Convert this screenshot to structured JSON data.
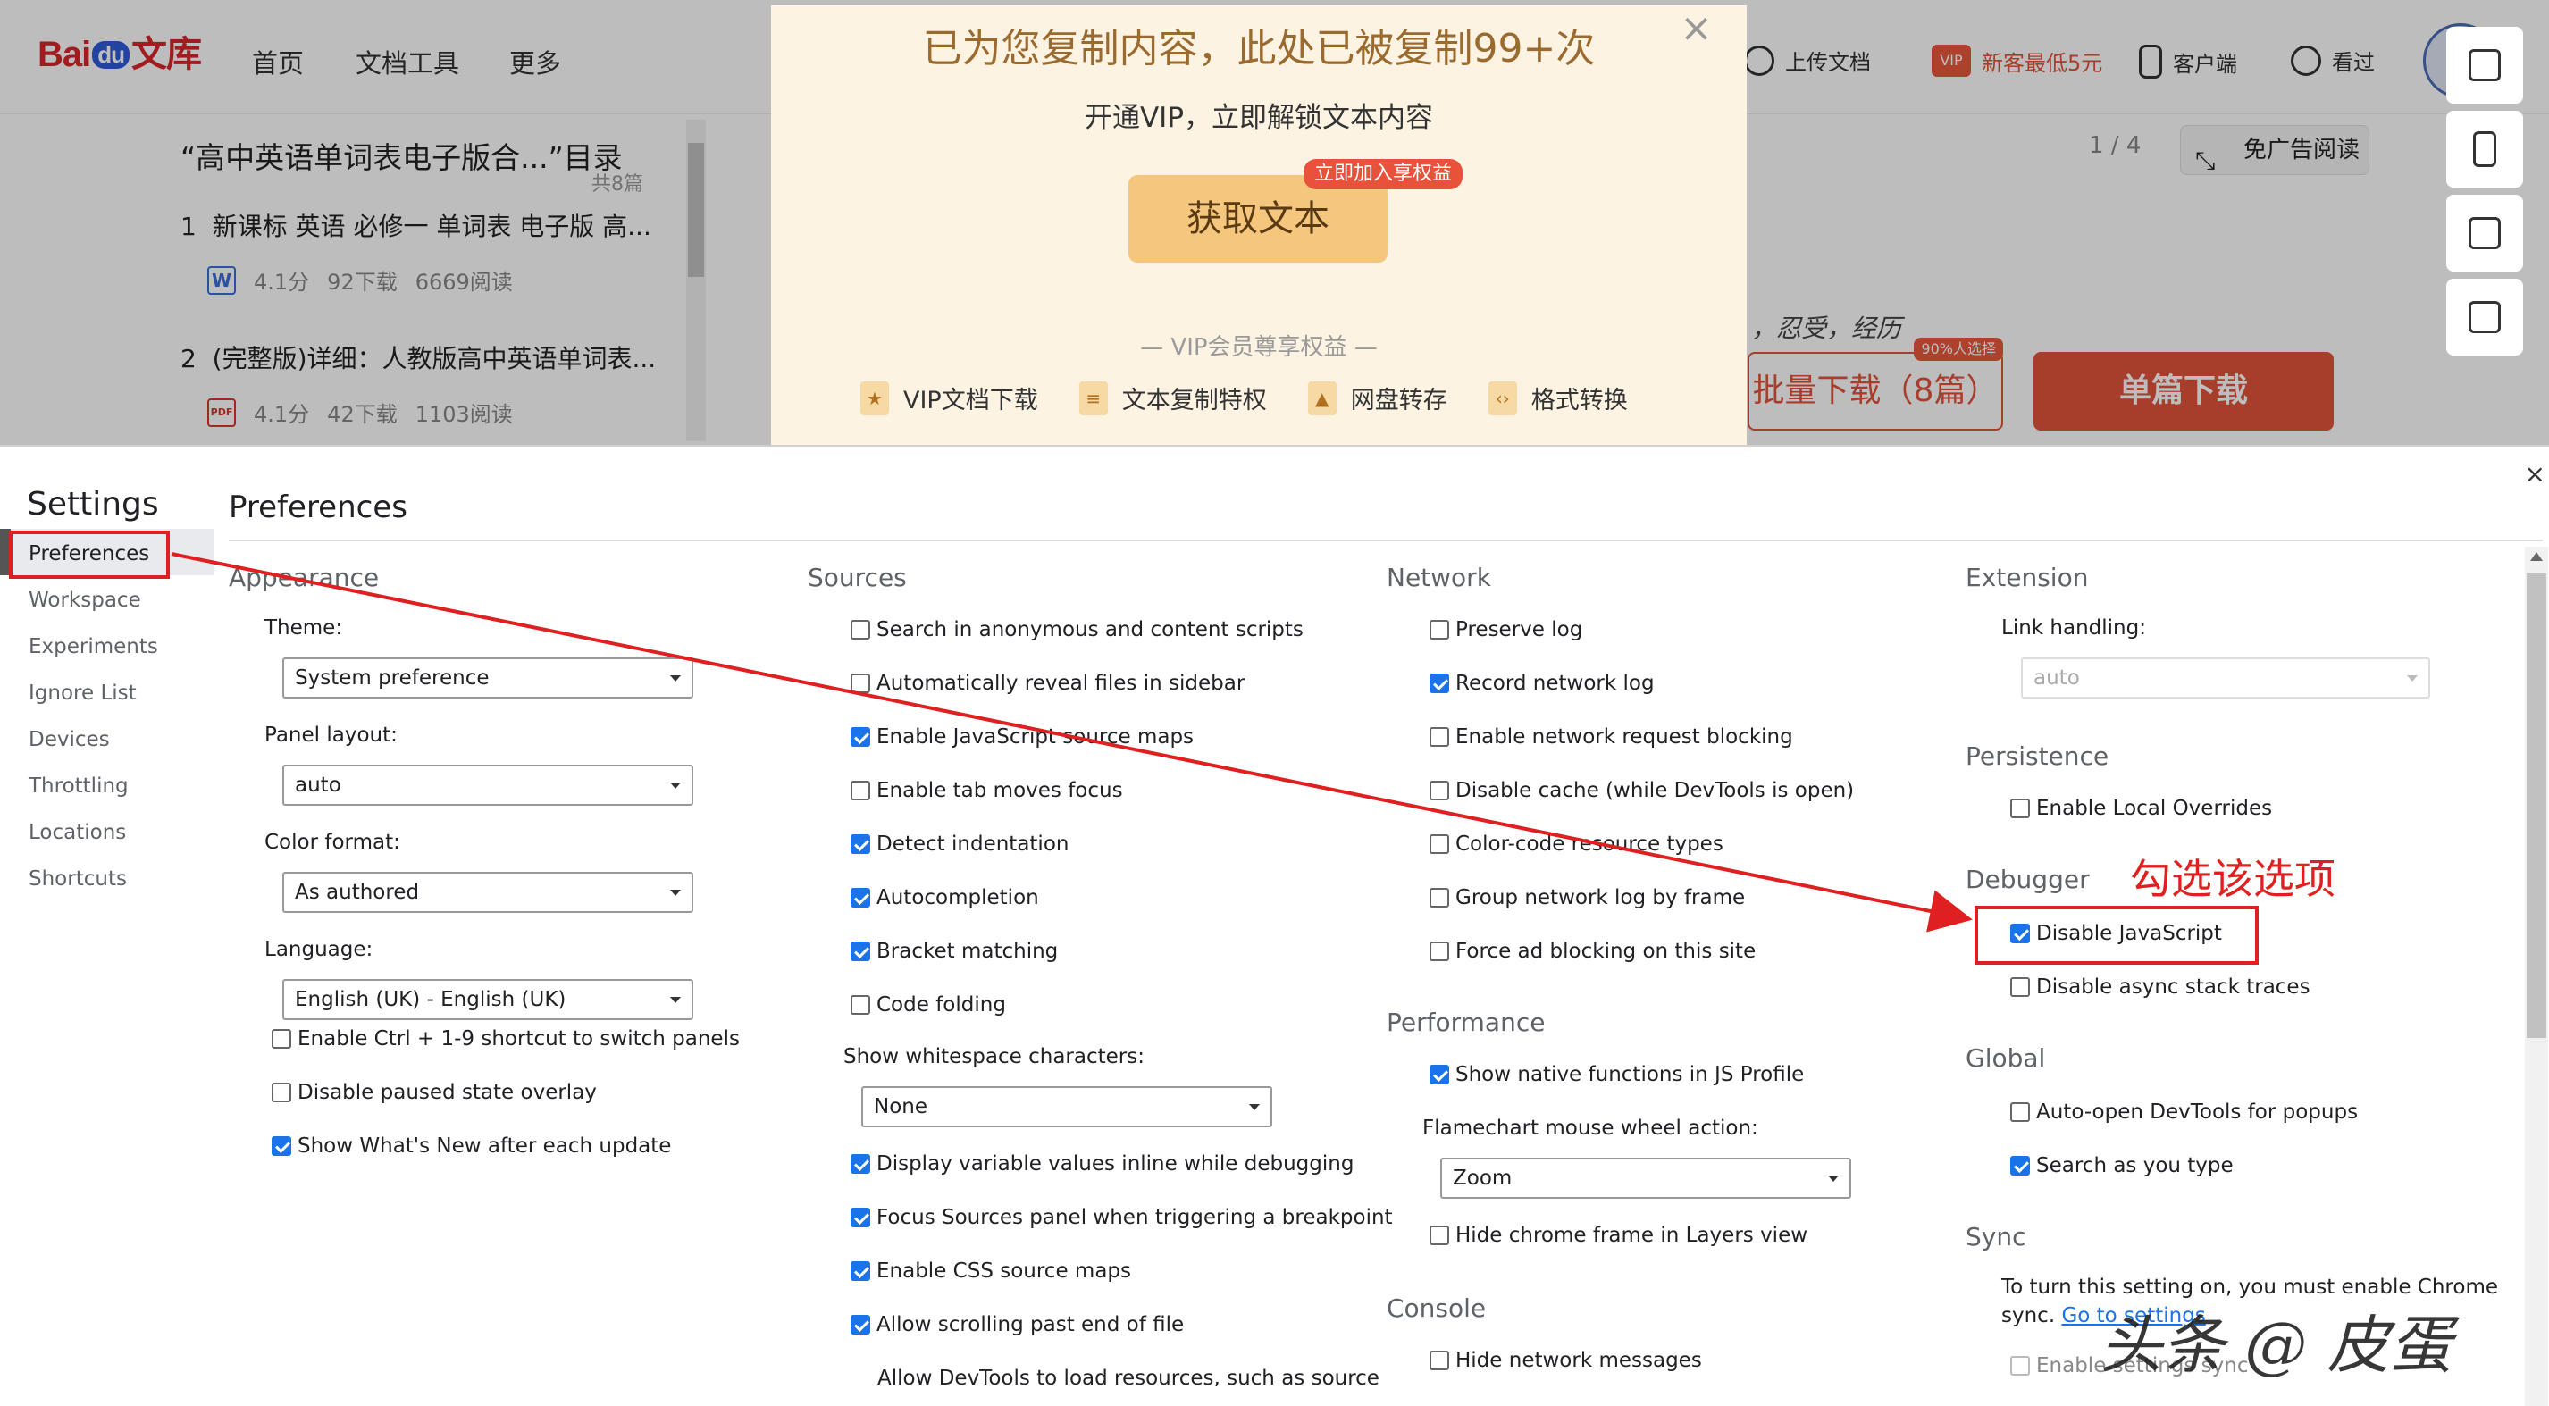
{
  "web": {
    "logo": {
      "left": "Bai",
      "du": "du",
      "right": "文库"
    },
    "nav_links": [
      "首页",
      "文档工具",
      "更多"
    ],
    "nav_right": {
      "upload": "上传文档",
      "vip_badge": "VIP",
      "promo": "新客最低5元",
      "client": "客户端",
      "history": "看过"
    },
    "toc": {
      "title": "“高中英语单词表电子版合...”目录",
      "count": "共8篇",
      "items": [
        {
          "index": "1",
          "title": "新课标 英语 必修一 单词表 电子版 高...",
          "type": "W",
          "score": "4.1分",
          "downloads": "92下载",
          "reads": "6669阅读"
        },
        {
          "index": "2",
          "title": "(完整版)详细：人教版高中英语单词表...",
          "type": "PDF",
          "score": "4.1分",
          "downloads": "42下载",
          "reads": "1103阅读"
        }
      ]
    },
    "page_indicator": "1 / 4",
    "no_ad": "免广告阅读",
    "doc_text": "，忍受，经历",
    "batch_download": "批量下载（8篇）",
    "batch_tag": "90%人选择",
    "single_download": "单篇下载"
  },
  "popup": {
    "title": "已为您复制内容，此处已被复制99+次",
    "subtitle": "开通VIP，立即解锁文本内容",
    "button": "获取文本",
    "badge": "立即加入享权益",
    "vip_title": "— VIP会员尊享权益 —",
    "features": [
      "VIP文档下载",
      "文本复制特权",
      "网盘转存",
      "格式转换"
    ],
    "close": "×"
  },
  "devtools": {
    "settings_title": "Settings",
    "close": "×",
    "nav": [
      "Preferences",
      "Workspace",
      "Experiments",
      "Ignore List",
      "Devices",
      "Throttling",
      "Locations",
      "Shortcuts"
    ],
    "page_title": "Preferences",
    "appearance": {
      "title": "Appearance",
      "theme_label": "Theme:",
      "theme_value": "System preference",
      "panel_label": "Panel layout:",
      "panel_value": "auto",
      "color_label": "Color format:",
      "color_value": "As authored",
      "lang_label": "Language:",
      "lang_value": "English (UK) - English (UK)",
      "checks": [
        {
          "label": "Enable Ctrl + 1-9 shortcut to switch panels",
          "checked": false
        },
        {
          "label": "Disable paused state overlay",
          "checked": false
        },
        {
          "label": "Show What's New after each update",
          "checked": true
        }
      ]
    },
    "sources": {
      "title": "Sources",
      "checks": [
        {
          "label": "Search in anonymous and content scripts",
          "checked": false
        },
        {
          "label": "Automatically reveal files in sidebar",
          "checked": false
        },
        {
          "label": "Enable JavaScript source maps",
          "checked": true
        },
        {
          "label": "Enable tab moves focus",
          "checked": false
        },
        {
          "label": "Detect indentation",
          "checked": true
        },
        {
          "label": "Autocompletion",
          "checked": true
        },
        {
          "label": "Bracket matching",
          "checked": true
        },
        {
          "label": "Code folding",
          "checked": false
        }
      ],
      "whitespace_label": "Show whitespace characters:",
      "whitespace_value": "None",
      "checks2": [
        {
          "label": "Display variable values inline while debugging",
          "checked": true
        },
        {
          "label": "Focus Sources panel when triggering a breakpoint",
          "checked": true
        },
        {
          "label": "Enable CSS source maps",
          "checked": true
        },
        {
          "label": "Allow scrolling past end of file",
          "checked": true
        }
      ],
      "cut_text": "Allow DevTools to load resources, such as source"
    },
    "network": {
      "title": "Network",
      "checks": [
        {
          "label": "Preserve log",
          "checked": false
        },
        {
          "label": "Record network log",
          "checked": true
        },
        {
          "label": "Enable network request blocking",
          "checked": false
        },
        {
          "label": "Disable cache (while DevTools is open)",
          "checked": false
        },
        {
          "label": "Color-code resource types",
          "checked": false
        },
        {
          "label": "Group network log by frame",
          "checked": false
        },
        {
          "label": "Force ad blocking on this site",
          "checked": false
        }
      ]
    },
    "performance": {
      "title": "Performance",
      "checks": [
        {
          "label": "Show native functions in JS Profile",
          "checked": true
        }
      ],
      "flame_label": "Flamechart mouse wheel action:",
      "flame_value": "Zoom",
      "checks2": [
        {
          "label": "Hide chrome frame in Layers view",
          "checked": false
        }
      ]
    },
    "console": {
      "title": "Console",
      "checks": [
        {
          "label": "Hide network messages",
          "checked": false
        }
      ]
    },
    "extension": {
      "title": "Extension",
      "link_label": "Link handling:",
      "link_value": "auto"
    },
    "persistence": {
      "title": "Persistence",
      "checks": [
        {
          "label": "Enable Local Overrides",
          "checked": false
        }
      ]
    },
    "debugger": {
      "title": "Debugger",
      "checks": [
        {
          "label": "Disable JavaScript",
          "checked": true
        },
        {
          "label": "Disable async stack traces",
          "checked": false
        }
      ]
    },
    "global": {
      "title": "Global",
      "checks": [
        {
          "label": "Auto-open DevTools for popups",
          "checked": false
        },
        {
          "label": "Search as you type",
          "checked": true
        }
      ]
    },
    "sync": {
      "title": "Sync",
      "text1": "To turn this setting on, you must enable Chrome",
      "text2": "sync.",
      "link": "Go to settings",
      "checks": [
        {
          "label": "Enable settings sync",
          "checked": false
        }
      ]
    }
  },
  "annotation": {
    "text": "勾选该选项",
    "color": "#e02020"
  },
  "watermark": "头条 @ 皮蛋"
}
